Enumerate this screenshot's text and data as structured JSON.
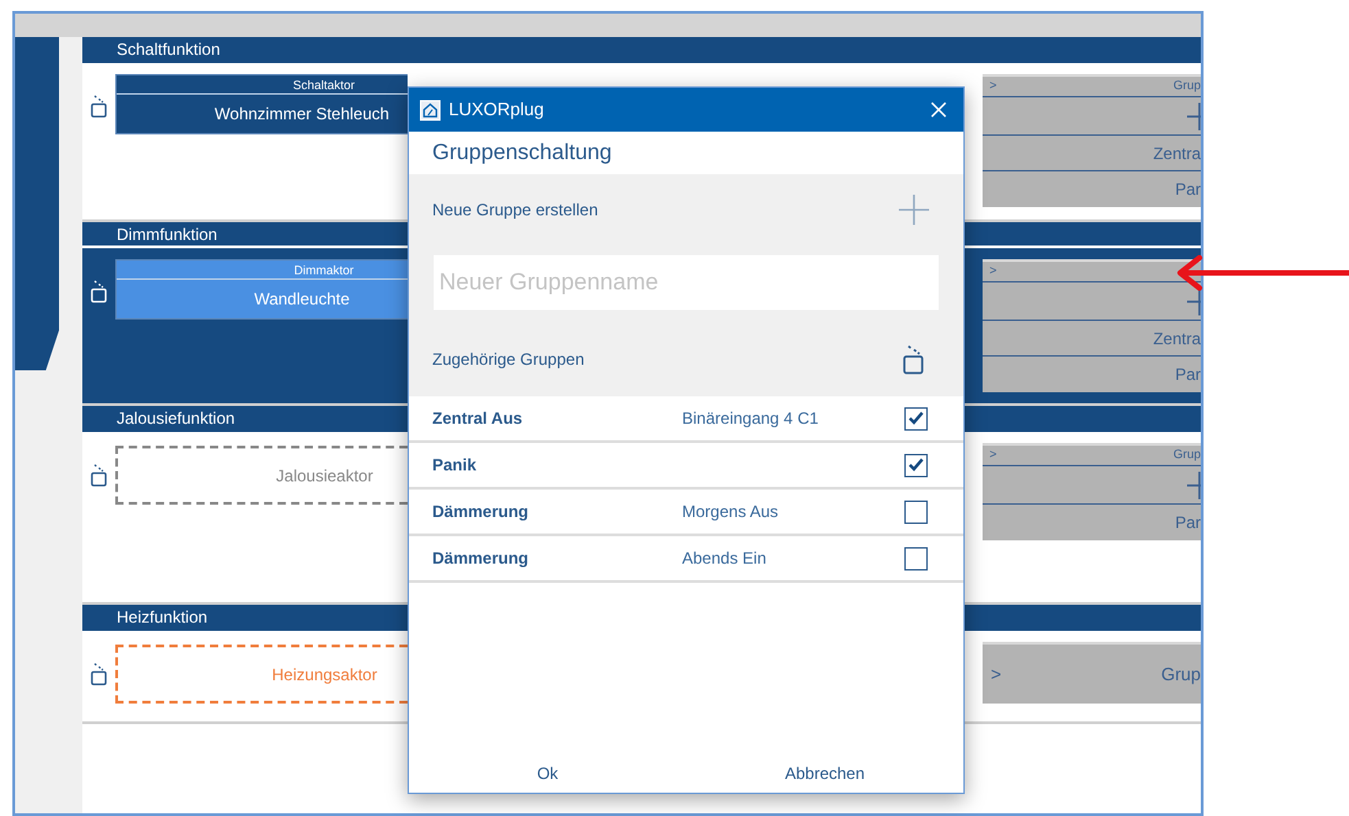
{
  "sections": [
    {
      "title": "Schaltfunktion",
      "highlighted": false,
      "actor": {
        "kind": "assigned",
        "label": "Schaltaktor",
        "name": "Wohnzimmer Stehleuch"
      },
      "groups": {
        "chevron": ">",
        "title": "Grup",
        "rows": [
          {
            "kind": "add"
          },
          {
            "kind": "text",
            "text": "Zentra"
          },
          {
            "kind": "text",
            "text": "Par"
          }
        ]
      }
    },
    {
      "title": "Dimmfunktion",
      "highlighted": true,
      "actor": {
        "kind": "selected",
        "label": "Dimmaktor",
        "name": "Wandleuchte"
      },
      "groups": {
        "chevron": ">",
        "rows": [
          {
            "kind": "add"
          },
          {
            "kind": "text",
            "text": "Zentra"
          },
          {
            "kind": "text",
            "text": "Par"
          }
        ]
      }
    },
    {
      "title": "Jalousiefunktion",
      "highlighted": false,
      "actor": {
        "kind": "empty",
        "name": "Jalousieaktor"
      },
      "groups": {
        "chevron": ">",
        "title": "Grup",
        "rows": [
          {
            "kind": "add"
          },
          {
            "kind": "text",
            "text": "Par"
          }
        ]
      }
    },
    {
      "title": "Heizfunktion",
      "highlighted": false,
      "actor": {
        "kind": "warning",
        "name": "Heizungsaktor"
      },
      "groups": {
        "chevron": ">",
        "title": "Grup"
      }
    }
  ],
  "dialog": {
    "title": "LUXORplug",
    "heading": "Gruppenschaltung",
    "create_label": "Neue Gruppe erstellen",
    "name_field": {
      "placeholder": "Neuer Gruppenname"
    },
    "groups_label": "Zugehörige Gruppen",
    "groups": [
      {
        "name": "Zentral Aus",
        "detail": "Binäreingang 4 C1",
        "checked": true
      },
      {
        "name": "Panik",
        "checked": true
      },
      {
        "name": "Dämmerung",
        "detail": "Morgens Aus",
        "checked": false
      },
      {
        "name": "Dämmerung",
        "detail": "Abends Ein",
        "checked": false
      }
    ],
    "buttons": [
      "Ok",
      "Abbrechen"
    ]
  }
}
